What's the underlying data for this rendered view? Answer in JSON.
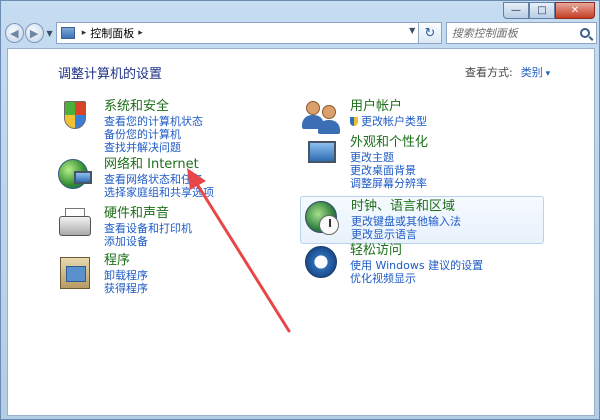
{
  "window": {
    "controls": [
      "—",
      "□",
      "✕"
    ]
  },
  "nav": {
    "address_text": "控制面板",
    "search_placeholder": "搜索控制面板"
  },
  "main": {
    "title": "调整计算机的设置",
    "view_by_label": "查看方式:",
    "view_by_value": "类别"
  },
  "left_categories": [
    {
      "title": "系统和安全",
      "links": [
        "查看您的计算机状态",
        "备份您的计算机",
        "查找并解决问题"
      ],
      "icon": "security-shield-icon"
    },
    {
      "title": "网络和 Internet",
      "links": [
        "查看网络状态和任务",
        "选择家庭组和共享选项"
      ],
      "icon": "network-globe-icon"
    },
    {
      "title": "硬件和声音",
      "links": [
        "查看设备和打印机",
        "添加设备"
      ],
      "icon": "printer-icon"
    },
    {
      "title": "程序",
      "links": [
        "卸载程序",
        "获得程序"
      ],
      "icon": "programs-box-icon"
    }
  ],
  "right_categories": [
    {
      "title": "用户帐户",
      "links": [
        "更改帐户类型"
      ],
      "icon": "users-icon"
    },
    {
      "title": "外观和个性化",
      "links": [
        "更改主题",
        "更改桌面背景",
        "调整屏幕分辨率"
      ],
      "icon": "monitor-icon"
    },
    {
      "title": "时钟、语言和区域",
      "links": [
        "更改键盘或其他输入法",
        "更改显示语言"
      ],
      "icon": "clock-globe-icon"
    },
    {
      "title": "轻松访问",
      "links": [
        "使用 Windows 建议的设置",
        "优化视频显示"
      ],
      "icon": "accessibility-icon"
    }
  ],
  "annotation": {
    "arrow_color": "#e8474a"
  }
}
